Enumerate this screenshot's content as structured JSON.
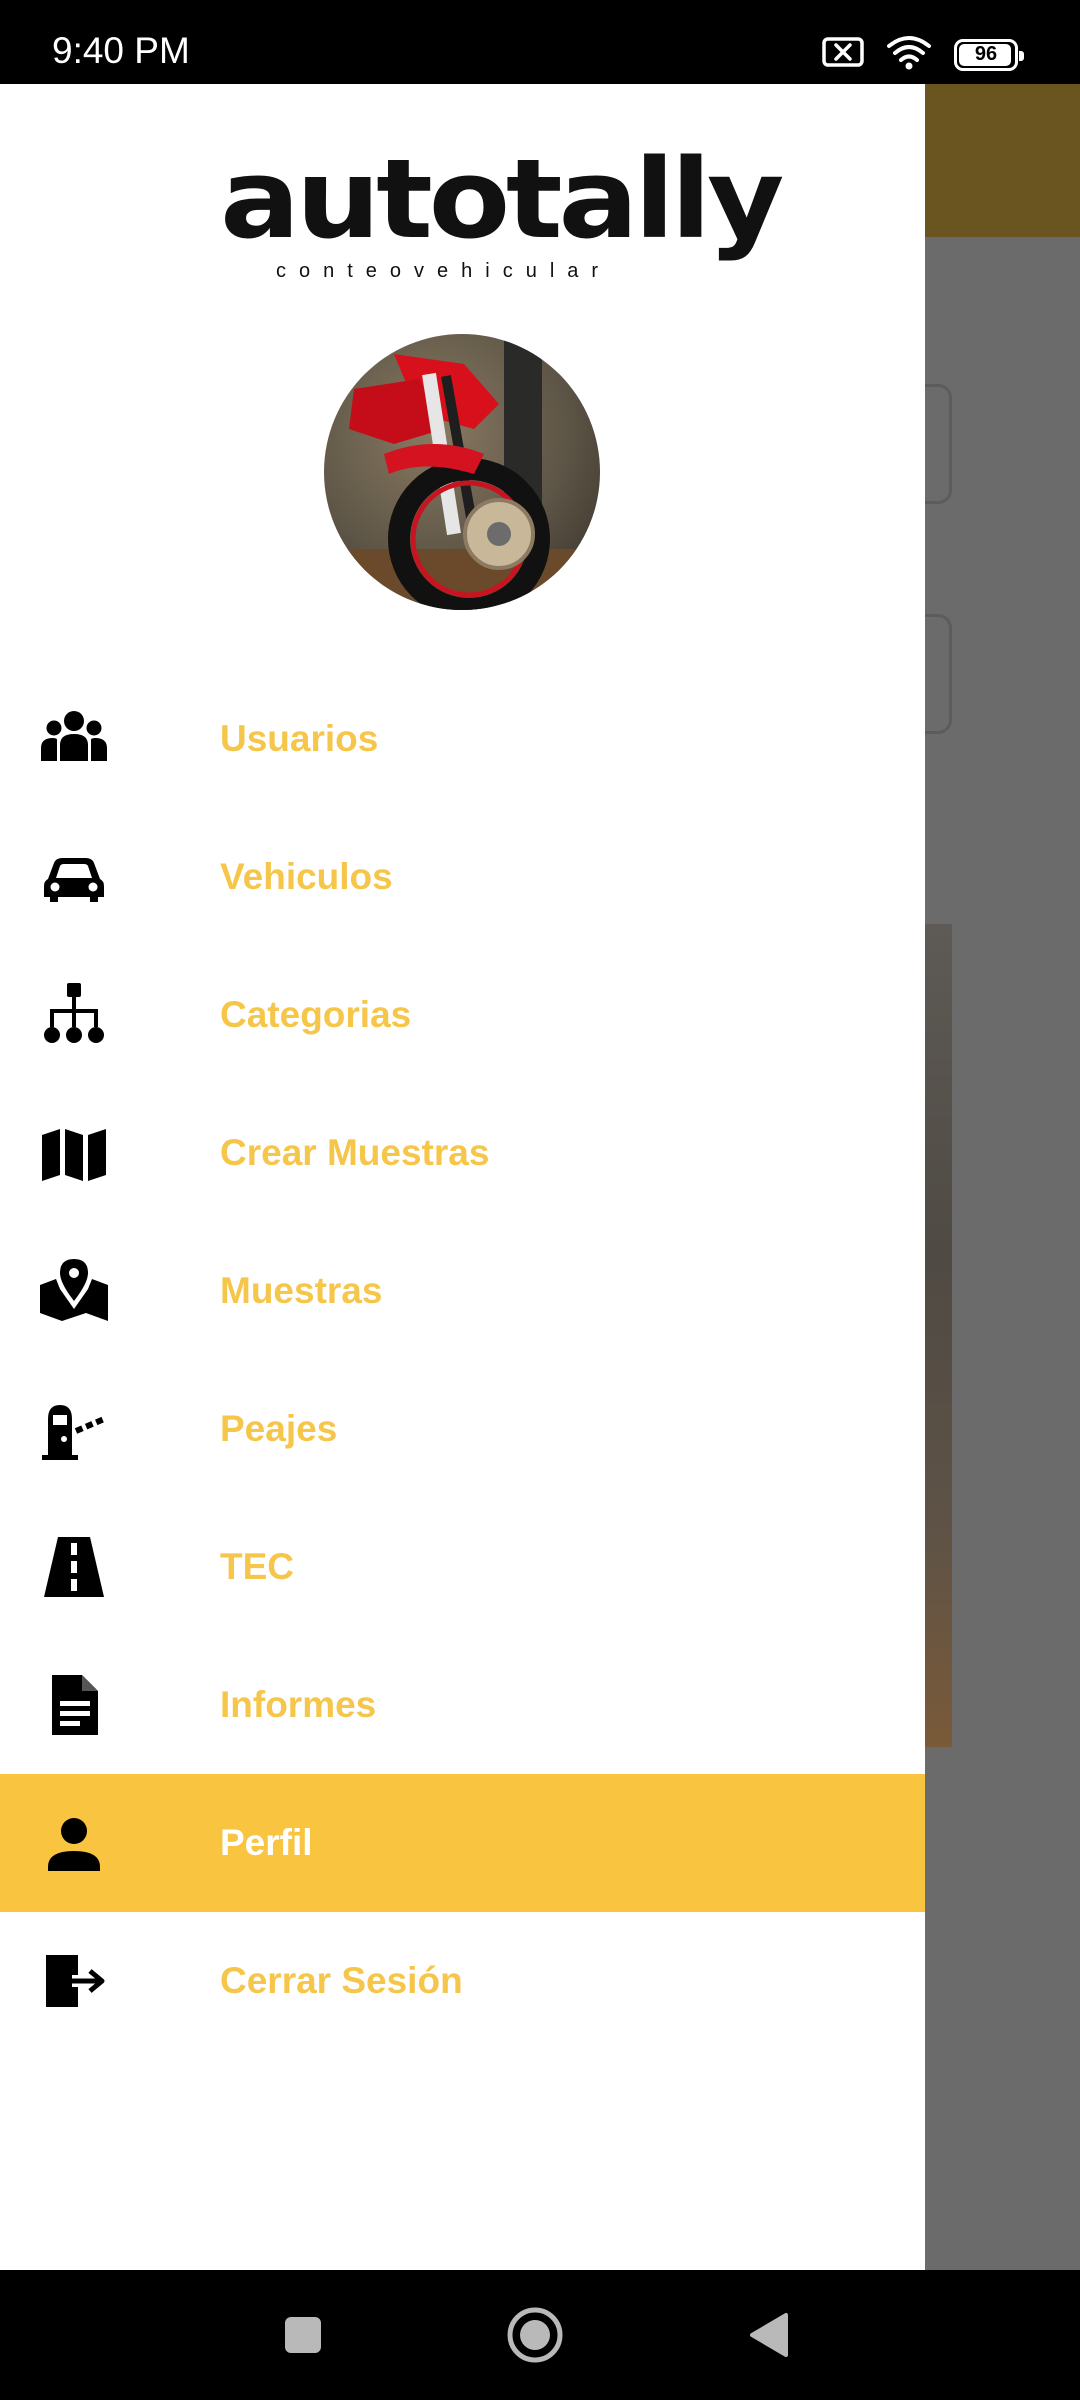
{
  "status_bar": {
    "time": "9:40 PM",
    "battery_percent": 96,
    "battery_label": "96",
    "icons": [
      "no-sim-icon",
      "wifi-icon",
      "battery-icon"
    ]
  },
  "drawer": {
    "logo": {
      "main": "autotally",
      "sub": "conteovehicular"
    },
    "menu": [
      {
        "label": "Usuarios",
        "icon": "users-icon",
        "active": false
      },
      {
        "label": "Vehiculos",
        "icon": "car-icon",
        "active": false
      },
      {
        "label": "Categorias",
        "icon": "sitemap-icon",
        "active": false
      },
      {
        "label": "Crear Muestras",
        "icon": "map-icon",
        "active": false
      },
      {
        "label": "Muestras",
        "icon": "map-pin-icon",
        "active": false
      },
      {
        "label": "Peajes",
        "icon": "toll-booth-icon",
        "active": false
      },
      {
        "label": "TEC",
        "icon": "road-icon",
        "active": false
      },
      {
        "label": "Informes",
        "icon": "document-icon",
        "active": false
      },
      {
        "label": "Perfil",
        "icon": "person-icon",
        "active": true
      },
      {
        "label": "Cerrar Sesión",
        "icon": "logout-icon",
        "active": false
      }
    ]
  },
  "colors": {
    "accent": "#f9c440",
    "menu_text": "#f5c64a",
    "active_text": "#ffffff",
    "scrim": "#6b6b6b"
  },
  "nav_bar": {
    "buttons": [
      "recents-button",
      "home-button",
      "back-button"
    ]
  }
}
